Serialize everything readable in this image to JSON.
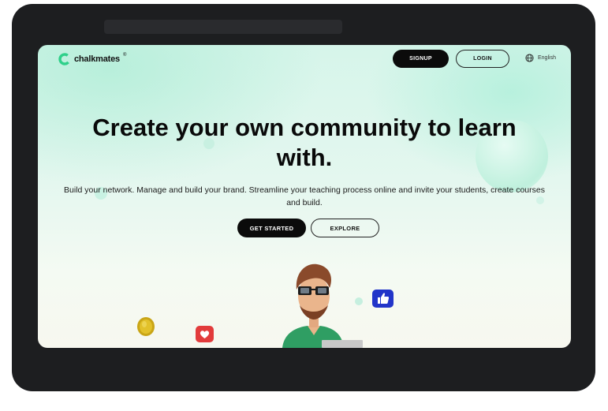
{
  "brand": {
    "name": "chalkmates",
    "registered": "®"
  },
  "nav": {
    "signup_label": "SIGNUP",
    "login_label": "LOGIN",
    "language": "English"
  },
  "hero": {
    "title": "Create your own community to learn with.",
    "subtitle": "Build your network. Manage and build your brand. Streamline your teaching process online and invite your students, create courses and build."
  },
  "cta": {
    "get_started_label": "GET STARTED",
    "explore_label": "EXPLORE"
  },
  "icons": {
    "logo": "chalkmates-logo-icon",
    "language": "globe-icon",
    "coin": "coin-icon",
    "heart": "heart-icon",
    "like": "thumbs-up-icon",
    "character": "avatar-illustration"
  },
  "colors": {
    "primary": "#0b0b0b",
    "accent": "#2fd08a",
    "background": "#d9f5ea"
  }
}
